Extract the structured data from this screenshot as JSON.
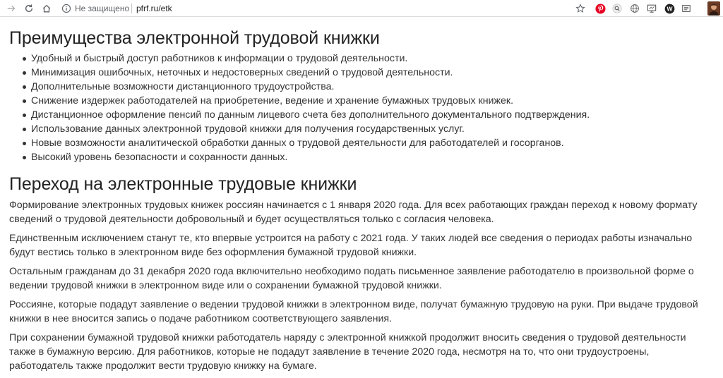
{
  "browser": {
    "security_label": "Не защищено",
    "url": "pfrf.ru/etk"
  },
  "advantages": {
    "title": "Преимущества электронной трудовой книжки",
    "items": [
      "Удобный и быстрый доступ работников к информации о трудовой деятельности.",
      "Минимизация ошибочных, неточных и недостоверных сведений о трудовой деятельности.",
      "Дополнительные возможности дистанционного трудоустройства.",
      "Снижение издержек работодателей на приобретение, ведение и хранение бумажных трудовых книжек.",
      "Дистанционное оформление пенсий по данным лицевого счета без дополнительного документального подтверждения.",
      "Использование данных электронной трудовой книжки для получения государственных услуг.",
      "Новые возможности аналитической обработки данных о трудовой деятельности для работодателей и госорганов.",
      "Высокий уровень безопасности и сохранности данных."
    ]
  },
  "transition": {
    "title": "Переход на электронные трудовые книжки",
    "paragraphs": [
      "Формирование электронных трудовых книжек россиян начинается с 1 января 2020 года. Для всех работающих граждан переход к новому формату сведений о трудовой деятельности добровольный и будет осуществляться только с согласия человека.",
      "Единственным исключением станут те, кто впервые устроится на работу с 2021 года. У таких людей все сведения о периодах работы изначально будут вестись только в электронном виде без оформления бумажной трудовой книжки.",
      "Остальным гражданам до 31 декабря 2020 года включительно необходимо подать письменное заявление работодателю в произвольной форме о ведении трудовой книжки в электронном виде или о сохранении бумажной трудовой книжки.",
      "Россияне, которые подадут заявление о ведении трудовой книжки в электронном виде, получат бумажную трудовую  на руки. При выдаче трудовой книжки в нее вносится запись о подаче работником соответствующего заявления.",
      "При сохранении бумажной трудовой книжки работодатель наряду с электронной книжкой продолжит вносить сведения о трудовой деятельности также в бумажную версию. Для работников, которые не подадут заявление в течение 2020 года, несмотря на то, что они трудоустроены, работодатель также продолжит вести трудовую книжку на бумаге."
    ]
  },
  "colors": {
    "pinterest": "#e60023",
    "text": "#333333",
    "heading": "#222222"
  },
  "icons": [
    "forward-icon",
    "reload-icon",
    "home-icon",
    "info-icon",
    "star-icon",
    "pinterest-icon",
    "search-ext-icon",
    "globe-icon",
    "screen-icon",
    "w-ext-icon",
    "menu-icon",
    "avatar"
  ]
}
